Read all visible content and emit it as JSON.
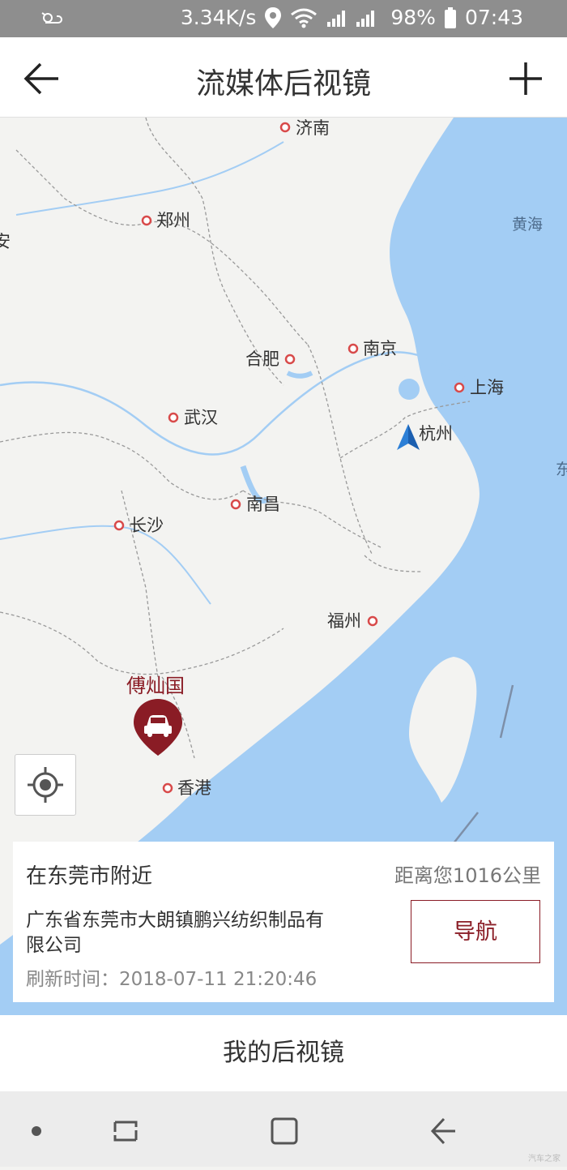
{
  "status_bar": {
    "speed": "3.34K/s",
    "battery": "98%",
    "time": "07:43",
    "icons": [
      "weather-icon",
      "location-pin-icon",
      "wifi-icon",
      "signal-icon",
      "battery-icon"
    ]
  },
  "app_bar": {
    "title": "流媒体后视镜",
    "back_icon": "back-arrow-icon",
    "add_icon": "plus-icon"
  },
  "map": {
    "cities": [
      "济南",
      "郑州",
      "合肥",
      "南京",
      "上海",
      "杭州",
      "武汉",
      "南昌",
      "长沙",
      "福州",
      "香港"
    ],
    "seas": [
      "黄海"
    ],
    "current_location_city": "杭州",
    "vehicle_marker_label": "傅灿国",
    "vehicle_icon": "car-marker-icon",
    "locate_icon": "locate-crosshair-icon",
    "partial_labels": [
      "安",
      "东"
    ]
  },
  "info_card": {
    "near_text": "在东莞市附近",
    "distance_text": "距离您1016公里",
    "address": "广东省东莞市大朗镇鹏兴纺织制品有限公司",
    "refresh_text": "刷新时间：2018-07-11  21:20:46",
    "nav_button": "导航"
  },
  "bottom": {
    "my_mirror": "我的后视镜"
  },
  "nav_bar": {
    "icons": [
      "dot-icon",
      "recent-apps-icon",
      "home-icon",
      "back-icon"
    ]
  },
  "colors": {
    "accent": "#8a1c25",
    "sea": "#a3cdf4",
    "land": "#f3f3f1",
    "river": "#a3cdf4"
  },
  "watermark": "汽车之家"
}
